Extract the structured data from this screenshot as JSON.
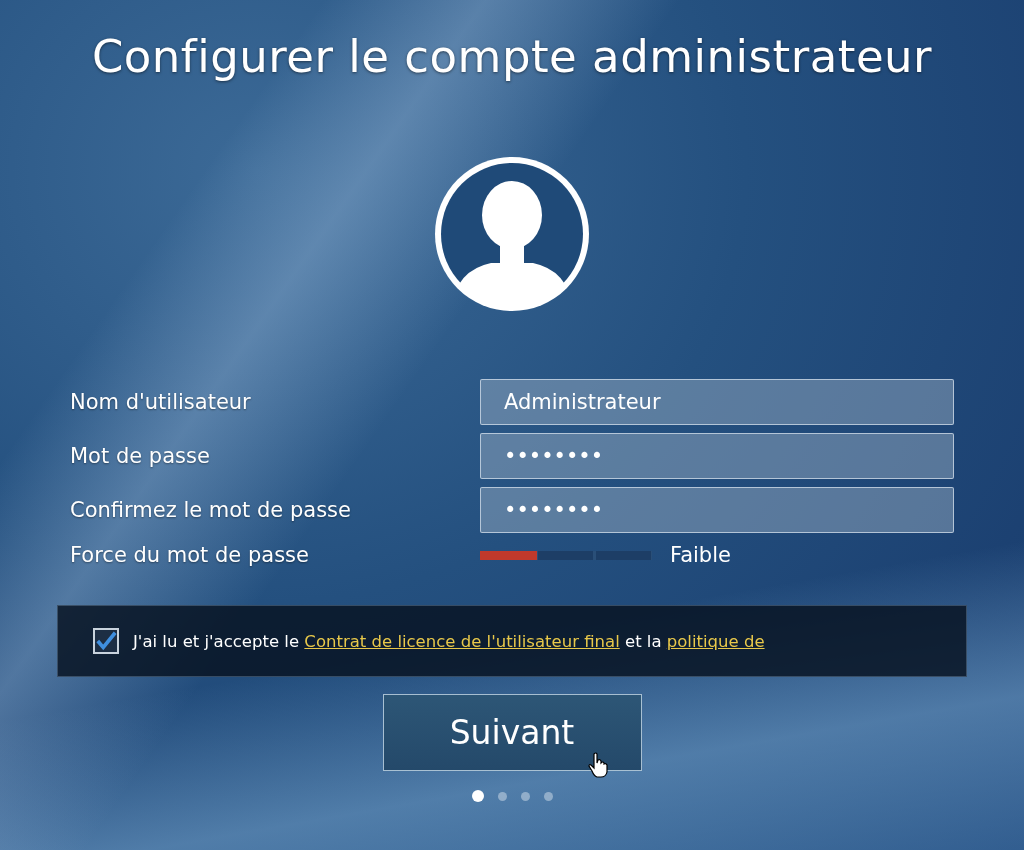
{
  "title": "Configurer le compte administrateur",
  "fields": [
    {
      "label": "Nom d'utilisateur",
      "value": "Administrateur"
    },
    {
      "label": "Mot de passe",
      "value": "••••••••"
    },
    {
      "label": "Confirmez le mot de passe",
      "value": "••••••••"
    }
  ],
  "strength": {
    "label": "Force du mot de passe",
    "level": 0.33,
    "reading": "Faible"
  },
  "agreement": {
    "checked": true,
    "parts": [
      {
        "kind": "text",
        "text": "J'ai lu et j'accepte le"
      },
      {
        "kind": "link",
        "text": "Contrat de licence de l'utilisateur final"
      },
      {
        "kind": "text",
        "text": "et la"
      },
      {
        "kind": "link",
        "text": "politique de"
      }
    ]
  },
  "next_button": "Suivant",
  "pages": [
    {
      "selected": true
    },
    {
      "selected": false
    },
    {
      "selected": false
    },
    {
      "selected": false
    }
  ]
}
